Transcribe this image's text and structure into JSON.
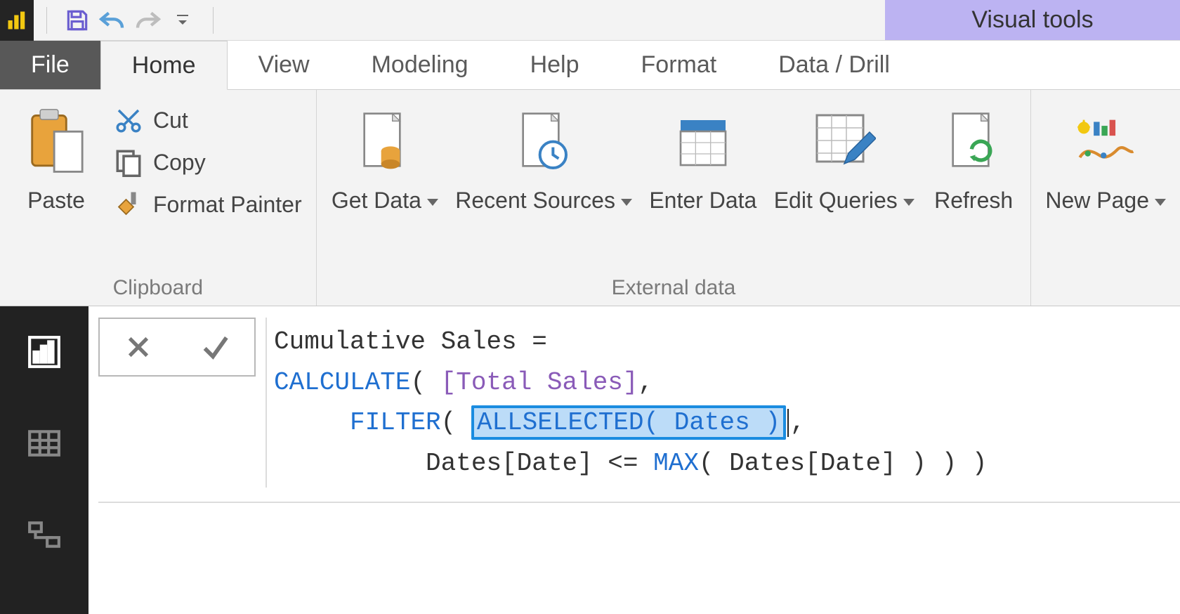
{
  "qat": {
    "contextual_tab": "Visual tools"
  },
  "tabs": {
    "file": "File",
    "home": "Home",
    "view": "View",
    "modeling": "Modeling",
    "help": "Help",
    "format": "Format",
    "datadrill": "Data / Drill"
  },
  "ribbon": {
    "clipboard": {
      "label": "Clipboard",
      "paste": "Paste",
      "cut": "Cut",
      "copy": "Copy",
      "format_painter": "Format Painter"
    },
    "external": {
      "label": "External data",
      "get_data": "Get\nData",
      "recent_sources": "Recent\nSources",
      "enter_data": "Enter\nData",
      "edit_queries": "Edit\nQueries",
      "refresh": "Refresh"
    },
    "insert": {
      "new_page": "New\nPage"
    }
  },
  "formula": {
    "line1_pre": "Cumulative Sales = ",
    "calc": "CALCULATE",
    "paren_open": "( ",
    "measure": "[Total Sales]",
    "after_measure": ",",
    "filter": "FILTER",
    "filter_open": "( ",
    "allsel": "ALLSELECTED( Dates )",
    "after_allsel": ",",
    "dates_cond_pre": "Dates[Date] <= ",
    "max": "MAX",
    "dates_cond_post": "( Dates[Date] ) ) )"
  }
}
